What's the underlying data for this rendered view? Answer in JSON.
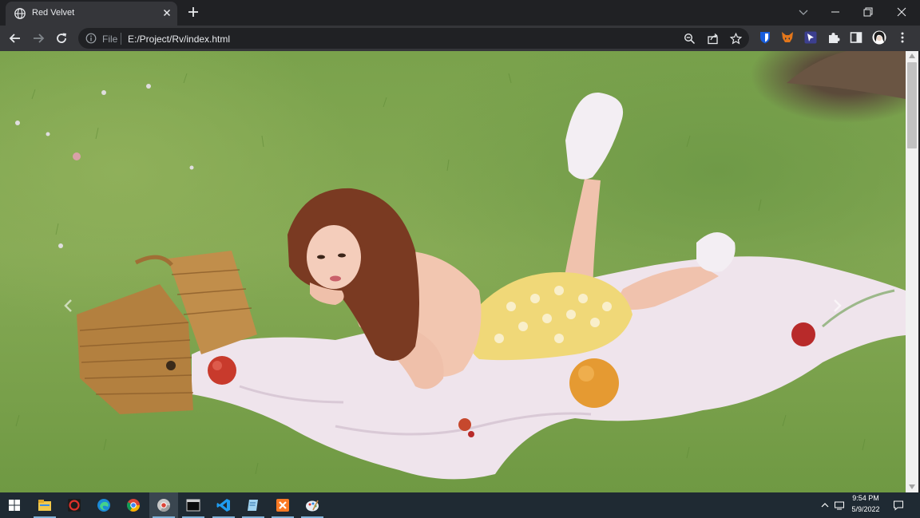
{
  "browser": {
    "tab": {
      "title": "Red Velvet",
      "favicon": "globe-icon"
    },
    "omnibox": {
      "scheme": "File",
      "url": "E:/Project/Rv/index.html"
    },
    "icons": {
      "back": "arrow-left-icon",
      "forward": "arrow-right-icon",
      "reload": "reload-icon",
      "zoom": "zoom-out-icon",
      "share": "share-icon",
      "bookmark": "star-icon",
      "extensions": [
        "bitwarden-icon",
        "metamask-icon",
        "extension-icon",
        "puzzle-icon",
        "side-panel-icon",
        "profile-avatar-icon",
        "kebab-menu-icon"
      ]
    }
  },
  "page": {
    "hero_alt": "photo of a woman lying on a white blanket in the grass beside a wicker picnic basket and fruit",
    "carousel": {
      "prev_icon": "chevron-left-icon",
      "next_icon": "chevron-right-icon"
    },
    "colors": {
      "grass": "#7aa24c",
      "blanket": "#efe4ec",
      "basket": "#b3803f",
      "dress": "#f0d878"
    }
  },
  "taskbar": {
    "apps": [
      "start-icon",
      "file-explorer-icon",
      "app-red-icon",
      "edge-icon",
      "chrome-icon",
      "chrome-dev-icon",
      "terminal-icon",
      "vscode-icon",
      "notepad-icon",
      "xampp-icon",
      "paint-icon"
    ],
    "clock": {
      "time": "9:54 PM",
      "date": "5/9/2022"
    }
  }
}
